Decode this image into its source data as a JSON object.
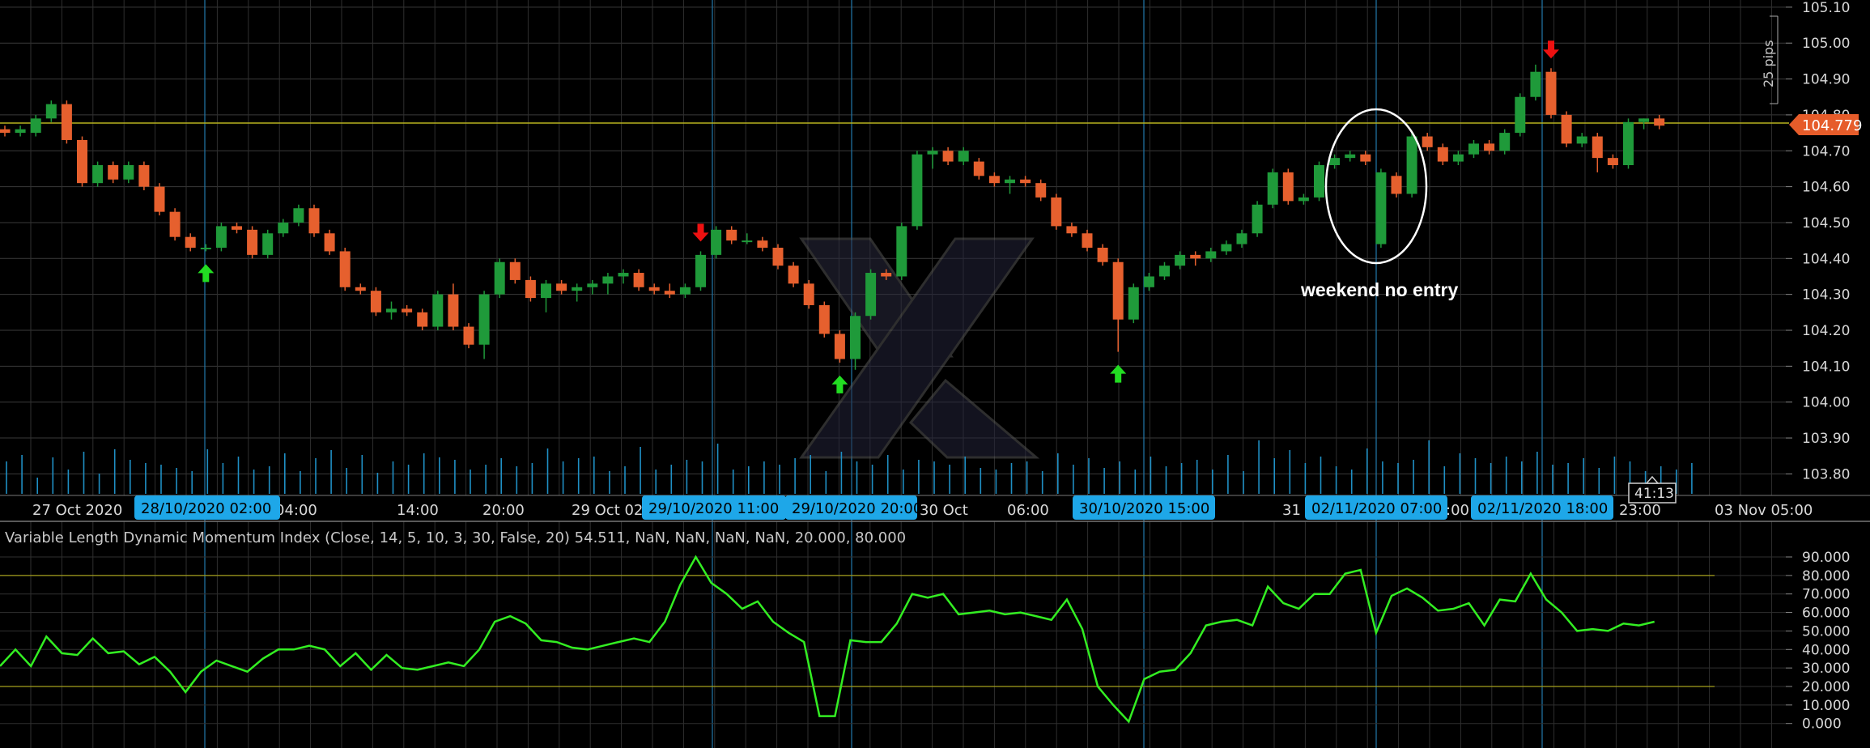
{
  "chart_data": [
    {
      "type": "candlestick",
      "symbol_pips_label": "25 pips",
      "current_price": "104.779",
      "countdown": "41:13",
      "ylim": [
        103.74,
        105.12
      ],
      "y_ticks": [
        "105.10",
        "105.00",
        "104.90",
        "104.80",
        "104.70",
        "104.60",
        "104.50",
        "104.40",
        "104.30",
        "104.20",
        "104.10",
        "104.00",
        "103.90",
        "103.80"
      ],
      "x_ticks": [
        "27 Oct 2020",
        "04:00",
        "14:00",
        "20:00",
        "29 Oct 02",
        "30 Oct",
        "06:00",
        "00",
        "31",
        ":00",
        "23:00",
        "03 Nov 05:00"
      ],
      "highlighted_times": [
        "28/10/2020 02:00",
        "29/10/2020 11:00",
        "29/10/2020 20:00",
        "30/10/2020 15:00",
        "02/11/2020 07:00",
        "02/11/2020 18:00"
      ],
      "annotation": "weekend no entry",
      "candles": [
        {
          "o": 104.76,
          "h": 104.77,
          "l": 104.74,
          "c": 104.75
        },
        {
          "o": 104.75,
          "h": 104.77,
          "l": 104.74,
          "c": 104.76
        },
        {
          "o": 104.75,
          "h": 104.8,
          "l": 104.74,
          "c": 104.79
        },
        {
          "o": 104.79,
          "h": 104.84,
          "l": 104.78,
          "c": 104.83
        },
        {
          "o": 104.83,
          "h": 104.84,
          "l": 104.72,
          "c": 104.73
        },
        {
          "o": 104.73,
          "h": 104.74,
          "l": 104.6,
          "c": 104.61
        },
        {
          "o": 104.61,
          "h": 104.67,
          "l": 104.6,
          "c": 104.66
        },
        {
          "o": 104.66,
          "h": 104.67,
          "l": 104.61,
          "c": 104.62
        },
        {
          "o": 104.62,
          "h": 104.67,
          "l": 104.61,
          "c": 104.66
        },
        {
          "o": 104.66,
          "h": 104.67,
          "l": 104.59,
          "c": 104.6
        },
        {
          "o": 104.6,
          "h": 104.61,
          "l": 104.52,
          "c": 104.53
        },
        {
          "o": 104.53,
          "h": 104.54,
          "l": 104.45,
          "c": 104.46
        },
        {
          "o": 104.46,
          "h": 104.47,
          "l": 104.42,
          "c": 104.43
        },
        {
          "o": 104.43,
          "h": 104.44,
          "l": 104.42,
          "c": 104.43
        },
        {
          "o": 104.43,
          "h": 104.5,
          "l": 104.42,
          "c": 104.49
        },
        {
          "o": 104.49,
          "h": 104.5,
          "l": 104.47,
          "c": 104.48
        },
        {
          "o": 104.48,
          "h": 104.49,
          "l": 104.4,
          "c": 104.41
        },
        {
          "o": 104.41,
          "h": 104.48,
          "l": 104.4,
          "c": 104.47
        },
        {
          "o": 104.47,
          "h": 104.51,
          "l": 104.46,
          "c": 104.5
        },
        {
          "o": 104.5,
          "h": 104.55,
          "l": 104.49,
          "c": 104.54
        },
        {
          "o": 104.54,
          "h": 104.55,
          "l": 104.46,
          "c": 104.47
        },
        {
          "o": 104.47,
          "h": 104.48,
          "l": 104.41,
          "c": 104.42
        },
        {
          "o": 104.42,
          "h": 104.43,
          "l": 104.31,
          "c": 104.32
        },
        {
          "o": 104.32,
          "h": 104.33,
          "l": 104.3,
          "c": 104.31
        },
        {
          "o": 104.31,
          "h": 104.32,
          "l": 104.24,
          "c": 104.25
        },
        {
          "o": 104.25,
          "h": 104.28,
          "l": 104.23,
          "c": 104.26
        },
        {
          "o": 104.26,
          "h": 104.27,
          "l": 104.24,
          "c": 104.25
        },
        {
          "o": 104.25,
          "h": 104.26,
          "l": 104.2,
          "c": 104.21
        },
        {
          "o": 104.21,
          "h": 104.31,
          "l": 104.2,
          "c": 104.3
        },
        {
          "o": 104.3,
          "h": 104.33,
          "l": 104.2,
          "c": 104.21
        },
        {
          "o": 104.21,
          "h": 104.22,
          "l": 104.15,
          "c": 104.16
        },
        {
          "o": 104.16,
          "h": 104.31,
          "l": 104.12,
          "c": 104.3
        },
        {
          "o": 104.3,
          "h": 104.4,
          "l": 104.29,
          "c": 104.39
        },
        {
          "o": 104.39,
          "h": 104.4,
          "l": 104.33,
          "c": 104.34
        },
        {
          "o": 104.34,
          "h": 104.35,
          "l": 104.28,
          "c": 104.29
        },
        {
          "o": 104.29,
          "h": 104.34,
          "l": 104.25,
          "c": 104.33
        },
        {
          "o": 104.33,
          "h": 104.34,
          "l": 104.3,
          "c": 104.31
        },
        {
          "o": 104.31,
          "h": 104.33,
          "l": 104.28,
          "c": 104.32
        },
        {
          "o": 104.32,
          "h": 104.34,
          "l": 104.3,
          "c": 104.33
        },
        {
          "o": 104.33,
          "h": 104.36,
          "l": 104.3,
          "c": 104.35
        },
        {
          "o": 104.35,
          "h": 104.37,
          "l": 104.33,
          "c": 104.36
        },
        {
          "o": 104.36,
          "h": 104.37,
          "l": 104.31,
          "c": 104.32
        },
        {
          "o": 104.32,
          "h": 104.33,
          "l": 104.3,
          "c": 104.31
        },
        {
          "o": 104.31,
          "h": 104.33,
          "l": 104.29,
          "c": 104.3
        },
        {
          "o": 104.3,
          "h": 104.33,
          "l": 104.29,
          "c": 104.32
        },
        {
          "o": 104.32,
          "h": 104.42,
          "l": 104.31,
          "c": 104.41
        },
        {
          "o": 104.41,
          "h": 104.49,
          "l": 104.4,
          "c": 104.48
        },
        {
          "o": 104.48,
          "h": 104.49,
          "l": 104.44,
          "c": 104.45
        },
        {
          "o": 104.45,
          "h": 104.47,
          "l": 104.44,
          "c": 104.45
        },
        {
          "o": 104.45,
          "h": 104.46,
          "l": 104.42,
          "c": 104.43
        },
        {
          "o": 104.43,
          "h": 104.44,
          "l": 104.37,
          "c": 104.38
        },
        {
          "o": 104.38,
          "h": 104.39,
          "l": 104.32,
          "c": 104.33
        },
        {
          "o": 104.33,
          "h": 104.34,
          "l": 104.26,
          "c": 104.27
        },
        {
          "o": 104.27,
          "h": 104.28,
          "l": 104.18,
          "c": 104.19
        },
        {
          "o": 104.19,
          "h": 104.2,
          "l": 104.11,
          "c": 104.12
        },
        {
          "o": 104.12,
          "h": 104.25,
          "l": 104.09,
          "c": 104.24
        },
        {
          "o": 104.24,
          "h": 104.37,
          "l": 104.23,
          "c": 104.36
        },
        {
          "o": 104.36,
          "h": 104.37,
          "l": 104.34,
          "c": 104.35
        },
        {
          "o": 104.35,
          "h": 104.5,
          "l": 104.34,
          "c": 104.49
        },
        {
          "o": 104.49,
          "h": 104.7,
          "l": 104.48,
          "c": 104.69
        },
        {
          "o": 104.69,
          "h": 104.71,
          "l": 104.65,
          "c": 104.7
        },
        {
          "o": 104.7,
          "h": 104.71,
          "l": 104.66,
          "c": 104.67
        },
        {
          "o": 104.67,
          "h": 104.71,
          "l": 104.66,
          "c": 104.7
        },
        {
          "o": 104.67,
          "h": 104.68,
          "l": 104.62,
          "c": 104.63
        },
        {
          "o": 104.63,
          "h": 104.64,
          "l": 104.6,
          "c": 104.61
        },
        {
          "o": 104.61,
          "h": 104.63,
          "l": 104.58,
          "c": 104.62
        },
        {
          "o": 104.62,
          "h": 104.63,
          "l": 104.6,
          "c": 104.61
        },
        {
          "o": 104.61,
          "h": 104.62,
          "l": 104.56,
          "c": 104.57
        },
        {
          "o": 104.57,
          "h": 104.58,
          "l": 104.48,
          "c": 104.49
        },
        {
          "o": 104.49,
          "h": 104.5,
          "l": 104.46,
          "c": 104.47
        },
        {
          "o": 104.47,
          "h": 104.48,
          "l": 104.42,
          "c": 104.43
        },
        {
          "o": 104.43,
          "h": 104.44,
          "l": 104.38,
          "c": 104.39
        },
        {
          "o": 104.39,
          "h": 104.4,
          "l": 104.14,
          "c": 104.23
        },
        {
          "o": 104.23,
          "h": 104.33,
          "l": 104.22,
          "c": 104.32
        },
        {
          "o": 104.32,
          "h": 104.36,
          "l": 104.31,
          "c": 104.35
        },
        {
          "o": 104.35,
          "h": 104.39,
          "l": 104.34,
          "c": 104.38
        },
        {
          "o": 104.38,
          "h": 104.42,
          "l": 104.37,
          "c": 104.41
        },
        {
          "o": 104.41,
          "h": 104.42,
          "l": 104.38,
          "c": 104.4
        },
        {
          "o": 104.4,
          "h": 104.43,
          "l": 104.39,
          "c": 104.42
        },
        {
          "o": 104.42,
          "h": 104.45,
          "l": 104.41,
          "c": 104.44
        },
        {
          "o": 104.44,
          "h": 104.48,
          "l": 104.43,
          "c": 104.47
        },
        {
          "o": 104.47,
          "h": 104.56,
          "l": 104.46,
          "c": 104.55
        },
        {
          "o": 104.55,
          "h": 104.65,
          "l": 104.54,
          "c": 104.64
        },
        {
          "o": 104.64,
          "h": 104.65,
          "l": 104.55,
          "c": 104.56
        },
        {
          "o": 104.56,
          "h": 104.58,
          "l": 104.55,
          "c": 104.57
        },
        {
          "o": 104.57,
          "h": 104.67,
          "l": 104.56,
          "c": 104.66
        },
        {
          "o": 104.66,
          "h": 104.69,
          "l": 104.65,
          "c": 104.68
        },
        {
          "o": 104.68,
          "h": 104.7,
          "l": 104.67,
          "c": 104.69
        },
        {
          "o": 104.69,
          "h": 104.7,
          "l": 104.66,
          "c": 104.67
        },
        {
          "o": 104.44,
          "h": 104.65,
          "l": 104.43,
          "c": 104.64
        },
        {
          "o": 104.63,
          "h": 104.64,
          "l": 104.57,
          "c": 104.58
        },
        {
          "o": 104.58,
          "h": 104.75,
          "l": 104.57,
          "c": 104.74
        },
        {
          "o": 104.74,
          "h": 104.75,
          "l": 104.7,
          "c": 104.71
        },
        {
          "o": 104.71,
          "h": 104.72,
          "l": 104.66,
          "c": 104.67
        },
        {
          "o": 104.67,
          "h": 104.7,
          "l": 104.66,
          "c": 104.69
        },
        {
          "o": 104.69,
          "h": 104.73,
          "l": 104.68,
          "c": 104.72
        },
        {
          "o": 104.72,
          "h": 104.73,
          "l": 104.69,
          "c": 104.7
        },
        {
          "o": 104.7,
          "h": 104.76,
          "l": 104.69,
          "c": 104.75
        },
        {
          "o": 104.75,
          "h": 104.86,
          "l": 104.74,
          "c": 104.85
        },
        {
          "o": 104.85,
          "h": 104.94,
          "l": 104.84,
          "c": 104.92
        },
        {
          "o": 104.92,
          "h": 104.93,
          "l": 104.79,
          "c": 104.8
        },
        {
          "o": 104.8,
          "h": 104.81,
          "l": 104.71,
          "c": 104.72
        },
        {
          "o": 104.72,
          "h": 104.75,
          "l": 104.71,
          "c": 104.74
        },
        {
          "o": 104.74,
          "h": 104.75,
          "l": 104.64,
          "c": 104.68
        },
        {
          "o": 104.68,
          "h": 104.69,
          "l": 104.65,
          "c": 104.66
        },
        {
          "o": 104.66,
          "h": 104.79,
          "l": 104.65,
          "c": 104.78
        },
        {
          "o": 104.78,
          "h": 104.79,
          "l": 104.76,
          "c": 104.79
        },
        {
          "o": 104.79,
          "h": 104.8,
          "l": 104.76,
          "c": 104.77
        }
      ],
      "volume": [
        40,
        48,
        20,
        45,
        30,
        52,
        25,
        55,
        42,
        38,
        36,
        32,
        28,
        55,
        38,
        46,
        30,
        34,
        50,
        28,
        44,
        54,
        32,
        48,
        26,
        40,
        36,
        50,
        45,
        42,
        30,
        36,
        44,
        34,
        38,
        56,
        40,
        44,
        46,
        28,
        34,
        58,
        30,
        36,
        42,
        40,
        62,
        30,
        34,
        40,
        36,
        44,
        48,
        28,
        52,
        40,
        36,
        48,
        30,
        42,
        40,
        36,
        46,
        32,
        30,
        38,
        40,
        28,
        50,
        36,
        44,
        32,
        40,
        30,
        46,
        34,
        38,
        42,
        30,
        48,
        28,
        66,
        44,
        54,
        38,
        46,
        34,
        30,
        56,
        40,
        38,
        42,
        66,
        34,
        50,
        44,
        38,
        46,
        40,
        52,
        36,
        38,
        44,
        32,
        46,
        40,
        28,
        34,
        30,
        38
      ],
      "buy_signals": [
        13,
        54,
        72
      ],
      "sell_signals": [
        45,
        100
      ]
    },
    {
      "type": "line",
      "title": "Variable Length Dynamic Momentum Index (Close, 14, 5, 10, 3, 30, False, 20) 54.511, NaN, NaN, NaN, NaN, 20.000, 80.000",
      "ylim": [
        -8,
        97
      ],
      "y_ticks": [
        "90.000",
        "80.000",
        "70.000",
        "60.000",
        "50.000",
        "40.000",
        "30.000",
        "20.000",
        "10.000",
        "0.000"
      ],
      "levels": [
        20,
        80
      ],
      "values": [
        31,
        40,
        31,
        47,
        38,
        37,
        46,
        38,
        39,
        32,
        36,
        28,
        17,
        28,
        34,
        31,
        28,
        35,
        40,
        40,
        42,
        40,
        31,
        38,
        29,
        37,
        30,
        29,
        31,
        33,
        31,
        40,
        55,
        58,
        54,
        45,
        44,
        41,
        40,
        42,
        44,
        46,
        44,
        55,
        75,
        90,
        76,
        70,
        62,
        66,
        55,
        49,
        44,
        4,
        4,
        45,
        44,
        44,
        54,
        70,
        68,
        70,
        59,
        60,
        61,
        59,
        60,
        58,
        56,
        67,
        51,
        20,
        10,
        1,
        24,
        28,
        29,
        38,
        53,
        55,
        56,
        53,
        74,
        65,
        62,
        70,
        70,
        81,
        83,
        49,
        69,
        73,
        68,
        61,
        62,
        65,
        53,
        67,
        66,
        81,
        67,
        60,
        50,
        51,
        50,
        54,
        53,
        55
      ]
    }
  ]
}
